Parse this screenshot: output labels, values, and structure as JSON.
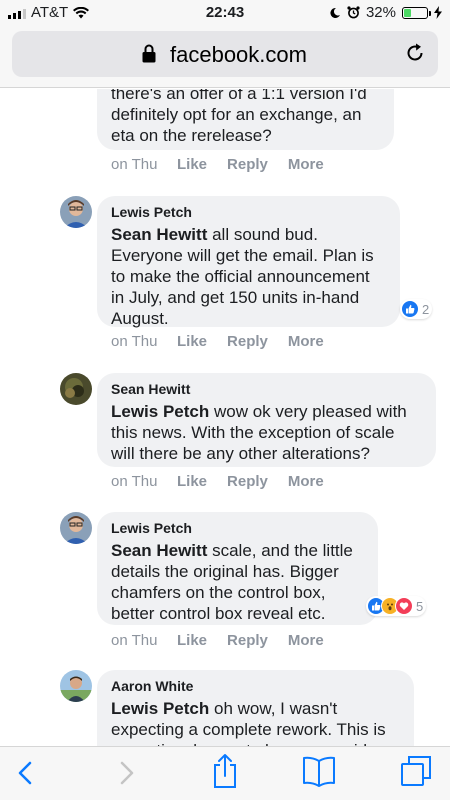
{
  "status": {
    "carrier": "AT&T",
    "time": "22:43",
    "battery": "32%",
    "battery_level": 0.32
  },
  "browser": {
    "url": "facebook.com"
  },
  "comments": [
    {
      "text": "there's an offer of a 1:1 version I'd definitely opt for an exchange, an eta on the rerelease?",
      "time": "on Thu",
      "like": "Like",
      "reply": "Reply",
      "more": "More"
    },
    {
      "author": "Lewis Petch",
      "mention": "Sean Hewitt",
      "text": " all sound bud. Everyone will get the email. Plan is to make the official announcement in July, and get 150 units in-hand August.",
      "time": "on Thu",
      "like": "Like",
      "reply": "Reply",
      "more": "More",
      "reaction_count": "2"
    },
    {
      "author": "Sean Hewitt",
      "mention": "Lewis Petch",
      "text": " wow ok very pleased with this news. With the exception of scale will there be any other alterations?",
      "time": "on Thu",
      "like": "Like",
      "reply": "Reply",
      "more": "More"
    },
    {
      "author": "Lewis Petch",
      "mention": "Sean Hewitt",
      "text": " scale, and the little details the original has. Bigger chamfers on the control box, better control box reveal etc.",
      "time": "on Thu",
      "like": "Like",
      "reply": "Reply",
      "more": "More",
      "reaction_count": "5"
    },
    {
      "author": "Aaron White",
      "mention": "Lewis Petch",
      "text": " oh wow, I wasn't expecting a complete rework. This is exceptional news to hear, on a side"
    }
  ],
  "colors": {
    "accent": "#1877f2",
    "bubble": "#f0f1f3",
    "meta": "#8d949e"
  }
}
